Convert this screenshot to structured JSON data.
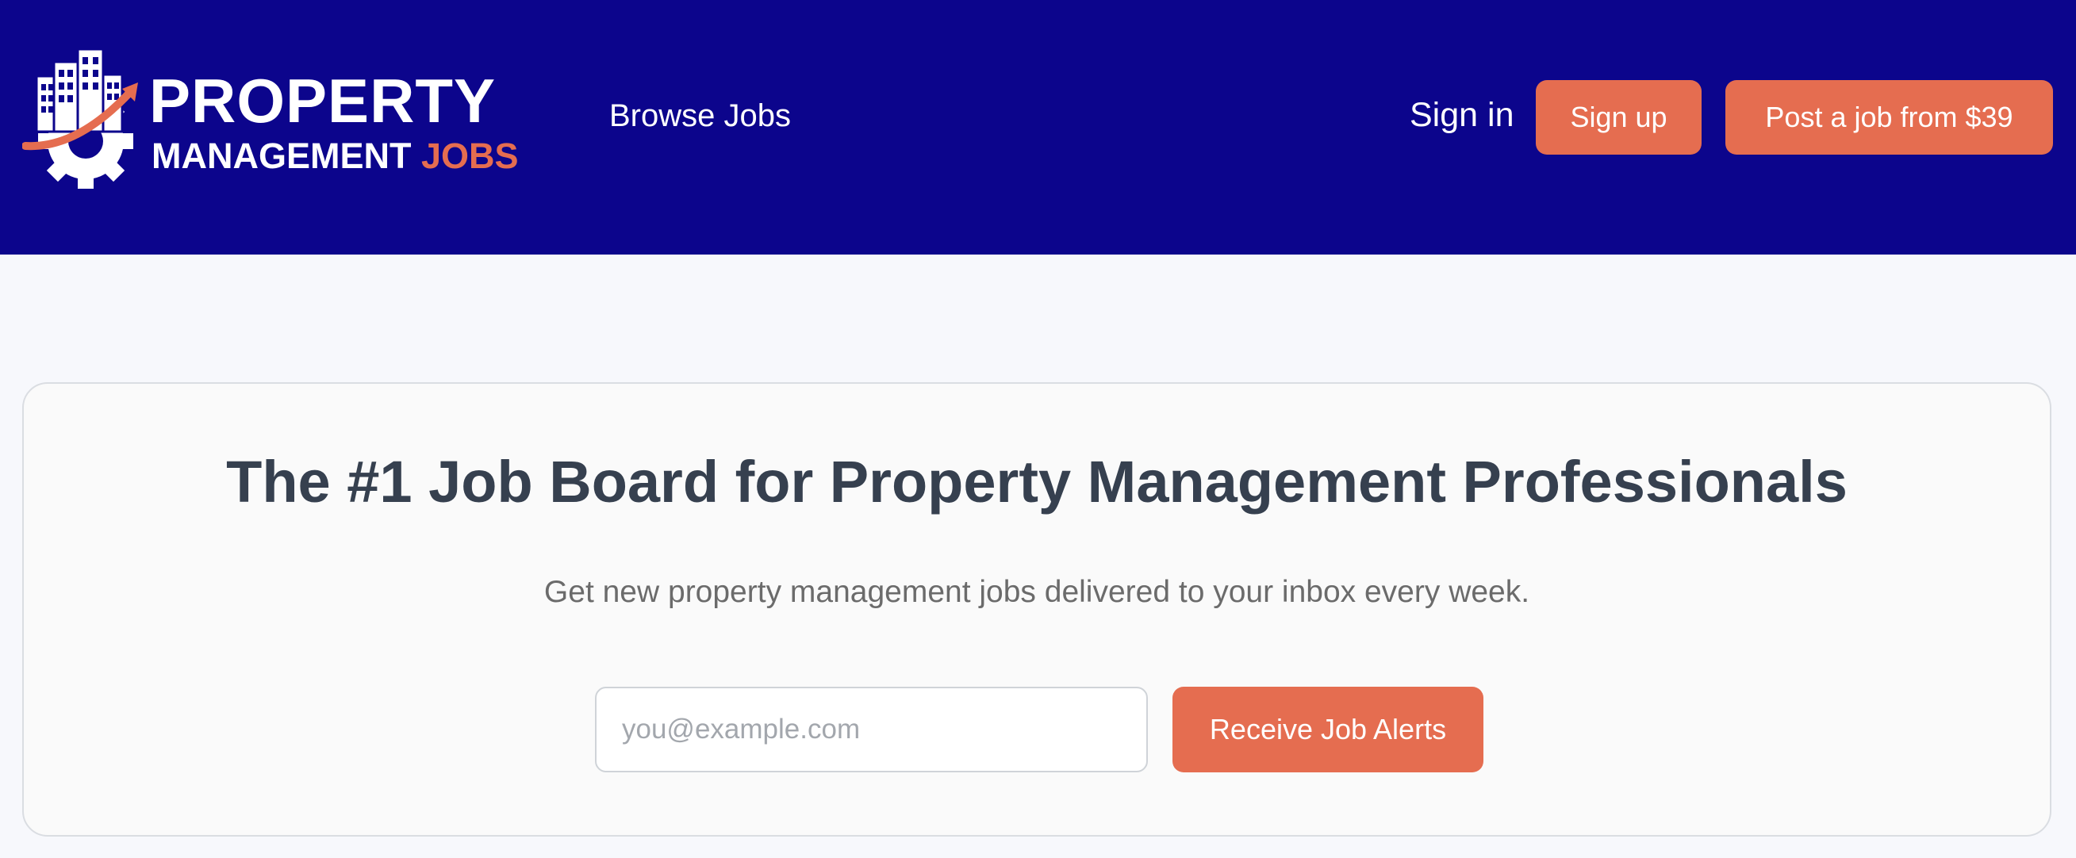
{
  "header": {
    "logo": {
      "line1": "PROPERTY",
      "line2_main": "MANAGEMENT",
      "line2_accent": "JOBS"
    },
    "nav": {
      "browse_jobs": "Browse Jobs",
      "sign_in": "Sign in",
      "sign_up": "Sign up",
      "post_job": "Post a job from $39"
    }
  },
  "hero": {
    "title": "The #1 Job Board for Property Management Professionals",
    "subtitle": "Get new property management jobs delivered to your inbox every week.",
    "email_placeholder": "you@example.com",
    "email_value": "",
    "submit_label": "Receive Job Alerts"
  },
  "colors": {
    "header_bg": "#0c058c",
    "accent": "#e56d50",
    "page_bg": "#f7f8fc",
    "title_text": "#36404f"
  },
  "icons": {
    "logo_icon": "buildings-gear-arrow-icon"
  }
}
